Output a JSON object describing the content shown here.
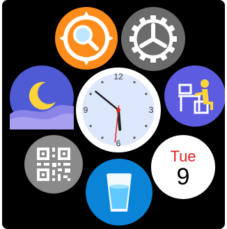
{
  "apps": {
    "search": {
      "icon": "compass-search-icon"
    },
    "settings": {
      "icon": "gear-icon"
    },
    "sleep": {
      "icon": "moon-icon"
    },
    "posture": {
      "icon": "sitting-person-desk-icon"
    },
    "qr": {
      "icon": "qr-code-icon"
    },
    "water": {
      "icon": "water-glass-icon"
    }
  },
  "date": {
    "weekday": "Tue",
    "day": "9"
  },
  "clock": {
    "numerals": {
      "n12": "12",
      "n3": "3",
      "n6": "6",
      "n9": "9"
    },
    "time": {
      "hour": 5,
      "minute": 51,
      "second": 31
    }
  },
  "colors": {
    "search": "#ff8c1a",
    "settings": "#6b6b6b",
    "sleep": "#4f5bd5",
    "posture": "#5d5ce0",
    "qr": "#8a8a8a",
    "water": "#0a84d6",
    "accent_red": "#e02020"
  }
}
